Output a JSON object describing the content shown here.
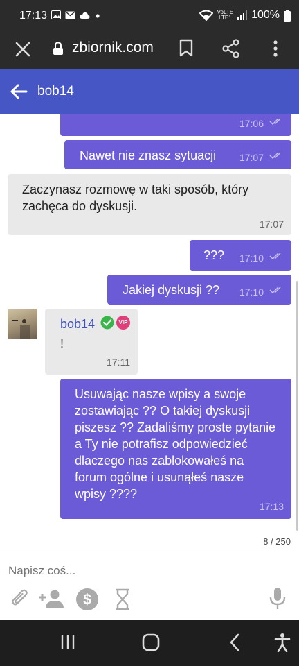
{
  "status_bar": {
    "time": "17:13",
    "battery": "100%",
    "lte_top": "VoLTE",
    "lte_bottom": "LTE1"
  },
  "browser": {
    "url": "zbiornik.com"
  },
  "chat": {
    "title": "bob14"
  },
  "messages": [
    {
      "text": "",
      "time": "17:06"
    },
    {
      "text": "Nawet nie znasz sytuacji",
      "time": "17:07"
    },
    {
      "lines": [
        "Zaczynasz rozmowę w taki sposób, który",
        "zachęca do dyskusji."
      ],
      "time": "17:07"
    },
    {
      "text": "???",
      "time": "17:10"
    },
    {
      "text": "Jakiej dyskusji ??",
      "time": "17:10"
    },
    {
      "sender": "bob14",
      "badge": "VIP",
      "text": "!",
      "time": "17:11"
    },
    {
      "lines": [
        "Usuwając nasze wpisy a swoje",
        "zostawiając ?? O takiej dyskusji",
        "piszesz ?? Zadaliśmy proste pytanie",
        "a Ty nie potrafisz odpowiedzieć",
        "dlaczego nas zablokowałeś na",
        "forum ogólne i usunąłeś nasze",
        "wpisy ????"
      ],
      "time": "17:13"
    }
  ],
  "counter": "8 / 250",
  "compose": {
    "placeholder": "Napisz coś..."
  },
  "colors": {
    "header": "#4656c4",
    "outgoing": "#6b5bd6",
    "incoming": "#e9e9e9",
    "verified": "#3bb54a",
    "vip": "#e0407a"
  }
}
